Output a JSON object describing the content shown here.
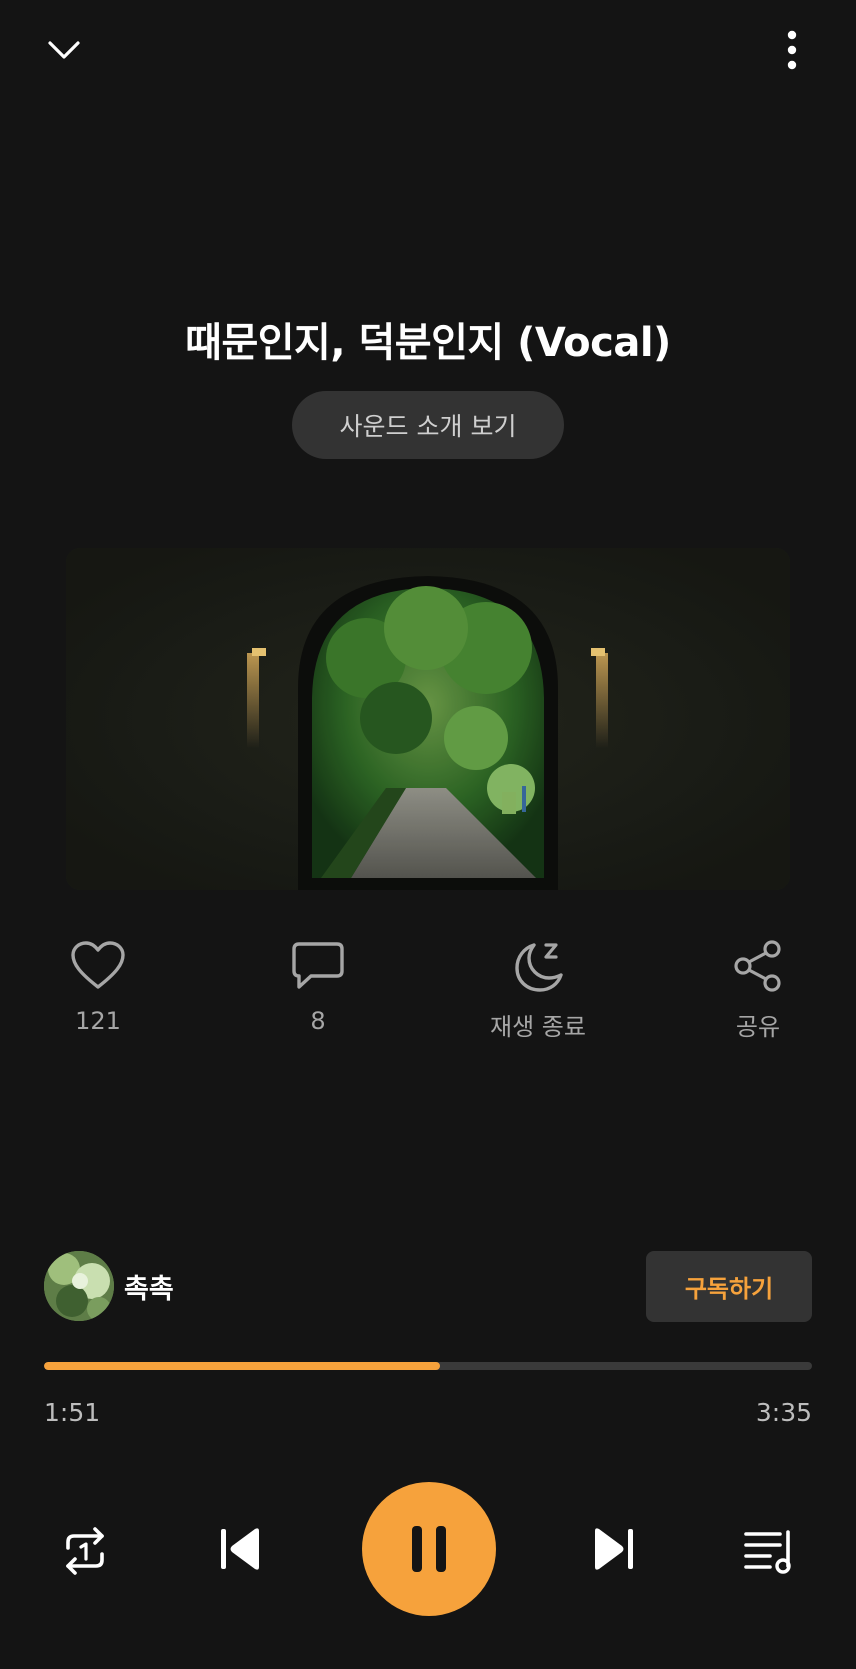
{
  "header": {
    "collapse_icon": "chevron-down-icon",
    "more_icon": "more-vertical-icon"
  },
  "track": {
    "title": "때문인지, 덕분인지 (Vocal)",
    "intro_button": "사운드 소개 보기",
    "artwork": "tunnel-forest-photo"
  },
  "actions": {
    "like_count": "121",
    "comment_count": "8",
    "sleep_label": "재생 종료",
    "share_label": "공유"
  },
  "artist": {
    "name": "촉촉",
    "subscribe_label": "구독하기"
  },
  "progress": {
    "current": "1:51",
    "total": "3:35",
    "fraction": 0.516
  },
  "colors": {
    "accent": "#f6a23c",
    "background": "#141414",
    "button_bg": "#333333"
  },
  "controls": {
    "repeat_icon": "repeat-one-icon",
    "prev_icon": "skip-previous-icon",
    "play_icon": "pause-icon",
    "next_icon": "skip-next-icon",
    "queue_icon": "playlist-icon"
  }
}
